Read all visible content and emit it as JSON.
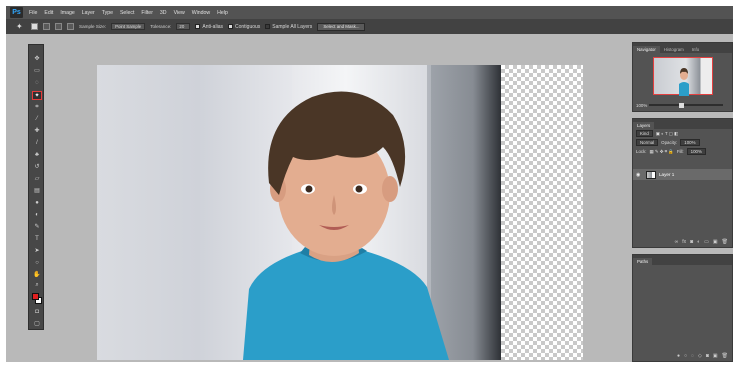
{
  "app": {
    "logo": "Ps"
  },
  "menu": [
    "File",
    "Edit",
    "Image",
    "Layer",
    "Type",
    "Select",
    "Filter",
    "3D",
    "View",
    "Window",
    "Help"
  ],
  "options": {
    "sample_size_label": "Sample Size:",
    "sample_size_value": "Point Sample",
    "tolerance_label": "Tolerance:",
    "tolerance_value": "20",
    "anti_alias": "Anti-alias",
    "contiguous": "Contiguous",
    "sample_all_layers": "Sample All Layers",
    "select_mask_button": "Select and Mask..."
  },
  "navigator": {
    "tabs": [
      "Navigator",
      "Histogram",
      "Info"
    ],
    "zoom": "100%"
  },
  "layers": {
    "title": "Layers",
    "kind": "Kind",
    "blend_mode": "Normal",
    "opacity_label": "Opacity:",
    "opacity_value": "100%",
    "lock_label": "Lock:",
    "fill_label": "Fill:",
    "fill_value": "100%",
    "layer_name": "Layer 1"
  },
  "paths": {
    "title": "Paths"
  },
  "colors": {
    "foreground": "#e02020",
    "background": "#ffffff",
    "shirt": "#2b9ec9"
  }
}
